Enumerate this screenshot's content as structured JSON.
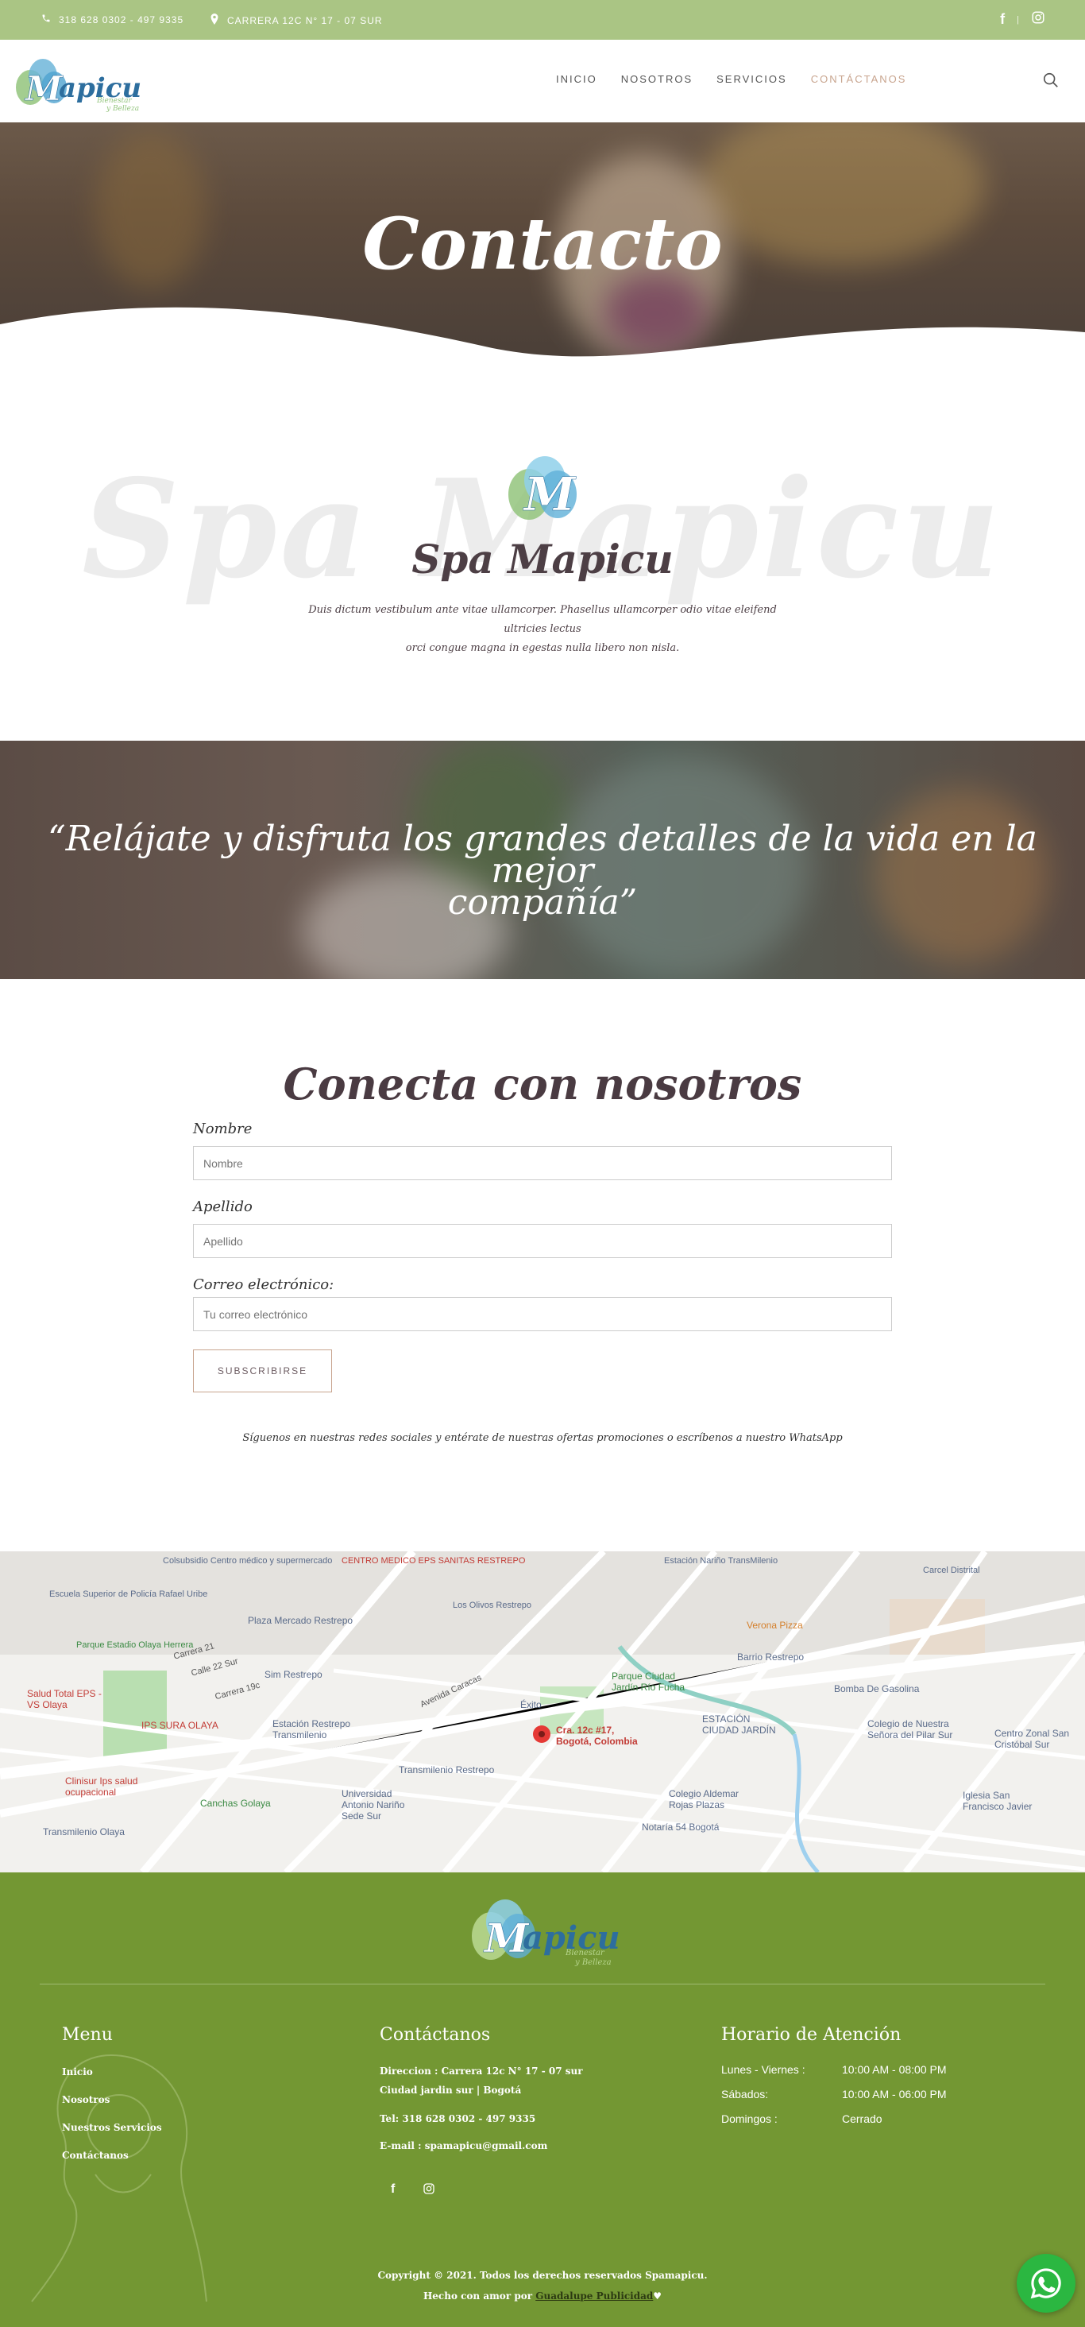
{
  "topbar": {
    "phone": "318 628 0302 - 497 9335",
    "address": "CARRERA 12C N° 17 - 07 SUR",
    "social": [
      "facebook-icon",
      "instagram-icon"
    ]
  },
  "header": {
    "logo_text": "Mapicu",
    "logo_sub1": "Bienestar",
    "logo_sub2": "y Belleza",
    "nav": [
      "INICIO",
      "NOSOTROS",
      "SERVICIOS",
      "CONTÁCTANOS"
    ],
    "active_nav": "CONTÁCTANOS"
  },
  "hero": {
    "title": "Contacto"
  },
  "intro": {
    "watermark": "Spa Mapicu",
    "title": "Spa Mapicu",
    "body_line1": "Duis dictum vestibulum ante vitae ullamcorper. Phasellus ullamcorper odio vitae eleifend ultricies lectus",
    "body_line2": "orci congue magna in egestas nulla libero non nisla."
  },
  "quote": {
    "line1": "“Relájate y disfruta los grandes detalles de la vida en la mejor",
    "line2": "compañía”"
  },
  "form": {
    "title": "Conecta con nosotros",
    "nombre_label": "Nombre",
    "nombre_placeholder": "Nombre",
    "apellido_label": "Apellido",
    "apellido_placeholder": "Apellido",
    "email_label": "Correo electrónico:",
    "email_placeholder": "Tu correo electrónico",
    "submit": "SUBSCRIBIRSE",
    "follow_text": "Síguenos en nuestras redes sociales y entérate de nuestras ofertas promociones o escríbenos a nuestro",
    "follow_link": "WhatsApp"
  },
  "map": {
    "pin_label_1": "Cra. 12c #17,",
    "pin_label_2": "Bogotá, Colombia",
    "labels": [
      "Colsubsidio Centro médico y supermercado",
      "CENTRO MEDICO EPS SANITAS RESTREPO",
      "Estación Nariño TransMilenio",
      "Carcel Distrital",
      "Escuela Superior de Policía Rafael Uribe",
      "Los Olivos Restrepo",
      "Plaza Mercado Restrepo",
      "Verona Pizza",
      "Parque Estadio Olaya Herrera",
      "Sim Restrepo",
      "Barrio Restrepo",
      "Parque Ciudad Jardín Río Fucha",
      "Bomba De Gasolina",
      "Salud Total EPS - VS Olaya",
      "Éxito",
      "IPS SURA OLAYA",
      "Estación Restrepo Transmilenio",
      "ESTACIÓN CIUDAD JARDÍN",
      "Colegio de Nuestra Señora del Pilar Sur",
      "Centro Zonal San Cristóbal Sur",
      "Transmilenio Restrepo",
      "Clinisur Ips salud ocupacional",
      "Canchas Golaya",
      "Universidad Antonio Nariño Sede Sur",
      "Colegio Aldemar Rojas Plazas",
      "Iglesia San Francisco Javier",
      "Notaría 54 Bogotá",
      "Transmilenio Olaya",
      "Avenida Caracas",
      "Calle 22 Sur",
      "Carrera 19c",
      "Carrera 21"
    ]
  },
  "footer": {
    "menu_title": "Menu",
    "menu": [
      "Inicio",
      "Nosotros",
      "Nuestros Servicios",
      "Contáctanos"
    ],
    "contact_title": "Contáctanos",
    "address_line1": "Direccion : Carrera 12c N° 17 - 07 sur",
    "address_line2": "Ciudad jardin sur | Bogotá",
    "tel": "Tel: 318 628 0302 - 497 9335",
    "email": "E-mail : spamapicu@gmail.com",
    "hours_title": "Horario de Atención",
    "hours": [
      {
        "day": "Lunes - Viernes :",
        "time": "10:00 AM - 08:00 PM"
      },
      {
        "day": "Sábados:",
        "time": "10:00 AM - 06:00 PM"
      },
      {
        "day": "Domingos :",
        "time": "Cerrado"
      }
    ],
    "copyright": "Copyright © 2021. Todos los derechos reservados Spamapicu.",
    "made_prefix": "Hecho con amor por",
    "made_link": "Guadalupe Publicidad",
    "made_suffix": "♥"
  },
  "colors": {
    "topbar": "#aac584",
    "footer": "#739733",
    "accent": "#c8a48e",
    "heading": "#4a3b42",
    "whatsapp": "#2bb741"
  }
}
